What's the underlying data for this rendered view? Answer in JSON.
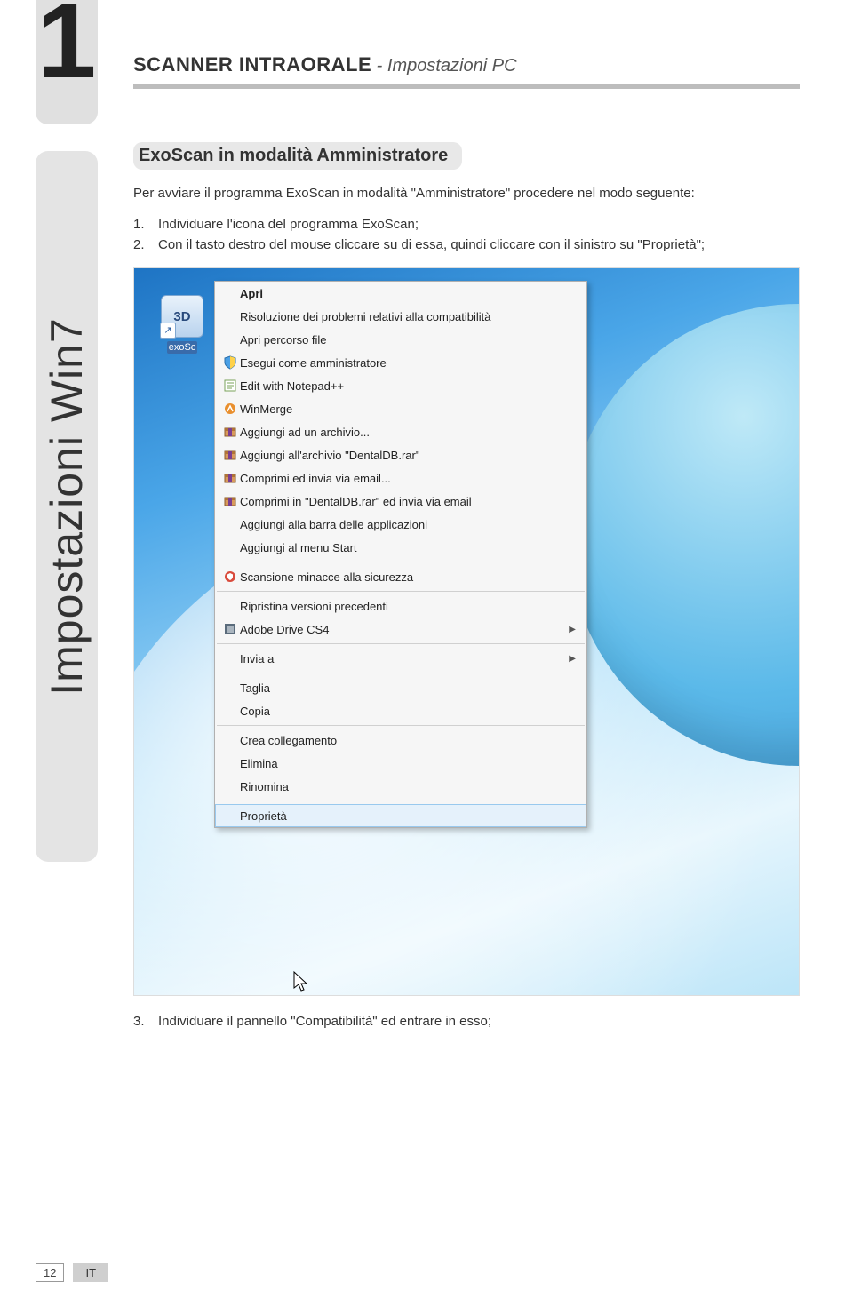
{
  "chapter_number": "1",
  "side_tab": "Impostazioni Win7",
  "header": {
    "title": "SCANNER INTRAORALE",
    "sep": " - ",
    "subtitle": "Impostazioni PC"
  },
  "subheading": "ExoScan in modalità Amministratore",
  "intro": "Per avviare il programma ExoScan in modalità \"Amministratore\" procedere nel modo seguente:",
  "steps": [
    {
      "num": "1.",
      "text": "Individuare l'icona del programma ExoScan;"
    },
    {
      "num": "2.",
      "text": "Con il tasto destro del mouse cliccare su di essa, quindi cliccare con il sinistro su \"Proprietà\";"
    }
  ],
  "after_step": {
    "num": "3.",
    "text": "Individuare il pannello \"Compatibilità\" ed entrare in esso;"
  },
  "desktop_icon": {
    "logo": "3D",
    "arrow": "↗",
    "label": "exoSc"
  },
  "context_menu": {
    "groups": [
      [
        {
          "key": "apri",
          "label": "Apri",
          "bold": true,
          "icon": null
        },
        {
          "key": "compat",
          "label": "Risoluzione dei problemi relativi alla compatibilità",
          "icon": null
        },
        {
          "key": "openloc",
          "label": "Apri percorso file",
          "icon": null
        },
        {
          "key": "admin",
          "label": "Esegui come amministratore",
          "icon": "shield"
        },
        {
          "key": "notepad",
          "label": "Edit with Notepad++",
          "icon": "note"
        },
        {
          "key": "winmerge",
          "label": "WinMerge",
          "icon": "winmerge"
        },
        {
          "key": "addarch",
          "label": "Aggiungi ad un archivio...",
          "icon": "rar"
        },
        {
          "key": "addrar",
          "label": "Aggiungi all'archivio \"DentalDB.rar\"",
          "icon": "rar"
        },
        {
          "key": "compmail",
          "label": "Comprimi ed invia via email...",
          "icon": "rar"
        },
        {
          "key": "comprarmail",
          "label": "Comprimi in \"DentalDB.rar\" ed invia via email",
          "icon": "rar"
        },
        {
          "key": "taskbar",
          "label": "Aggiungi alla barra delle applicazioni",
          "icon": null
        },
        {
          "key": "startmenu",
          "label": "Aggiungi al menu Start",
          "icon": null
        }
      ],
      [
        {
          "key": "scan",
          "label": "Scansione minacce alla sicurezza",
          "icon": "redshield"
        }
      ],
      [
        {
          "key": "restore",
          "label": "Ripristina versioni precedenti",
          "icon": null
        },
        {
          "key": "adobe",
          "label": "Adobe Drive CS4",
          "icon": "adobe",
          "submenu": true
        }
      ],
      [
        {
          "key": "sendto",
          "label": "Invia a",
          "icon": null,
          "submenu": true
        }
      ],
      [
        {
          "key": "cut",
          "label": "Taglia",
          "icon": null
        },
        {
          "key": "copy",
          "label": "Copia",
          "icon": null
        }
      ],
      [
        {
          "key": "shortcut",
          "label": "Crea collegamento",
          "icon": null
        },
        {
          "key": "delete",
          "label": "Elimina",
          "icon": null
        },
        {
          "key": "rename",
          "label": "Rinomina",
          "icon": null
        }
      ],
      [
        {
          "key": "props",
          "label": "Proprietà",
          "icon": null,
          "hover": true
        }
      ]
    ]
  },
  "footer": {
    "page": "12",
    "lang": "IT"
  }
}
